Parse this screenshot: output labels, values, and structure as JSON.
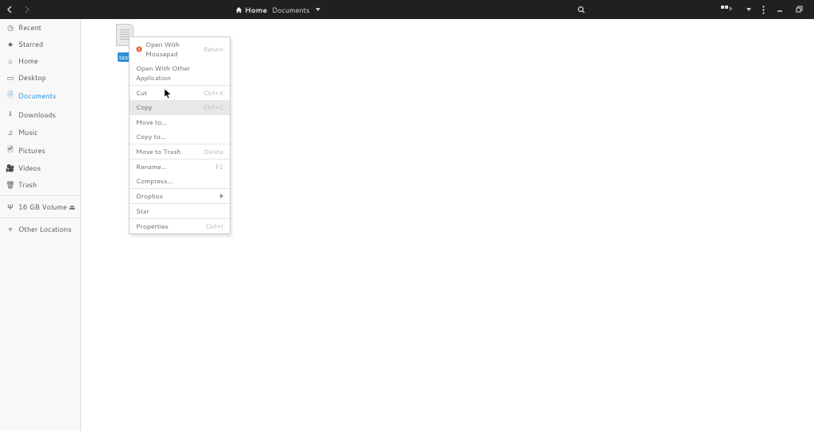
{
  "header": {
    "path1": "Home",
    "path2": "Documents"
  },
  "sidebar": {
    "items": [
      {
        "label": "Recent"
      },
      {
        "label": "Starred"
      },
      {
        "label": "Home"
      },
      {
        "label": "Desktop"
      },
      {
        "label": "Documents"
      },
      {
        "label": "Downloads"
      },
      {
        "label": "Music"
      },
      {
        "label": "Pictures"
      },
      {
        "label": "Videos"
      },
      {
        "label": "Trash"
      }
    ],
    "volume_label": "16 GB Volume",
    "other_locations": "Other Locations"
  },
  "file": {
    "name": "test"
  },
  "context_menu": {
    "open_with": "Open With Mousepad",
    "open_with_kbd": "Return",
    "open_other": "Open With Other Application",
    "cut": "Cut",
    "cut_kbd": "Ctrl+X",
    "copy": "Copy",
    "copy_kbd": "Ctrl+C",
    "move_to": "Move to…",
    "copy_to": "Copy to…",
    "move_trash": "Move to Trash",
    "move_trash_kbd": "Delete",
    "rename": "Rename…",
    "rename_kbd": "F2",
    "compress": "Compress…",
    "dropbox": "Dropbox",
    "star": "Star",
    "properties": "Properties",
    "properties_kbd": "Ctrl+I"
  }
}
